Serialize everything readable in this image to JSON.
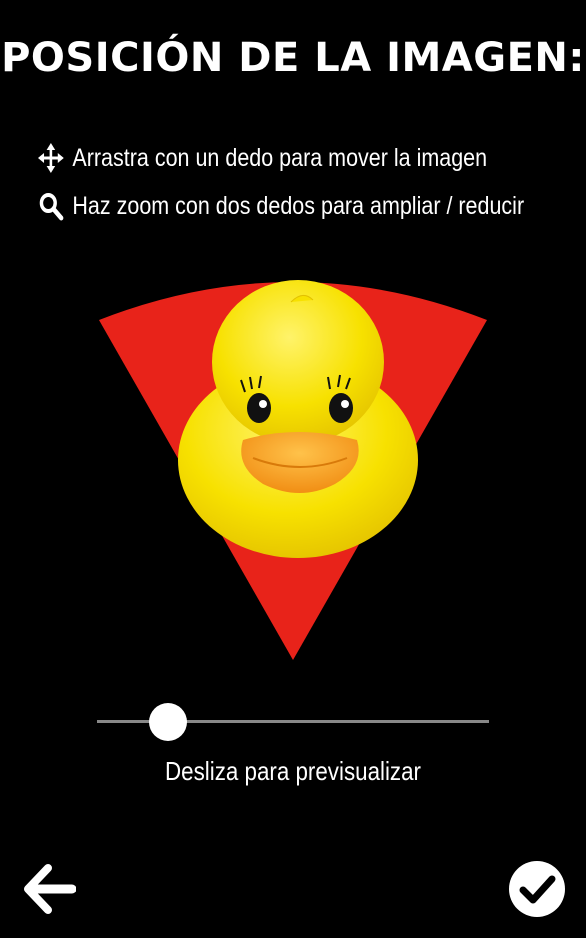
{
  "header": {
    "title": "POSICIÓN DE LA IMAGEN:"
  },
  "instructions": [
    {
      "icon": "move-icon",
      "text": "Arrastra con un dedo para mover la imagen"
    },
    {
      "icon": "search-icon",
      "text": "Haz zoom con dos dedos para ampliar / reducir"
    }
  ],
  "preview": {
    "subject": "rubber-duck",
    "shape": "pizza-slice",
    "background_color": "#e8231a",
    "duck_color": "#f7e100",
    "beak_color": "#f6a020"
  },
  "slider": {
    "value": 0.18,
    "hint": "Desliza para previsualizar"
  },
  "footer": {
    "back_icon": "arrow-left-icon",
    "confirm_icon": "check-icon"
  }
}
